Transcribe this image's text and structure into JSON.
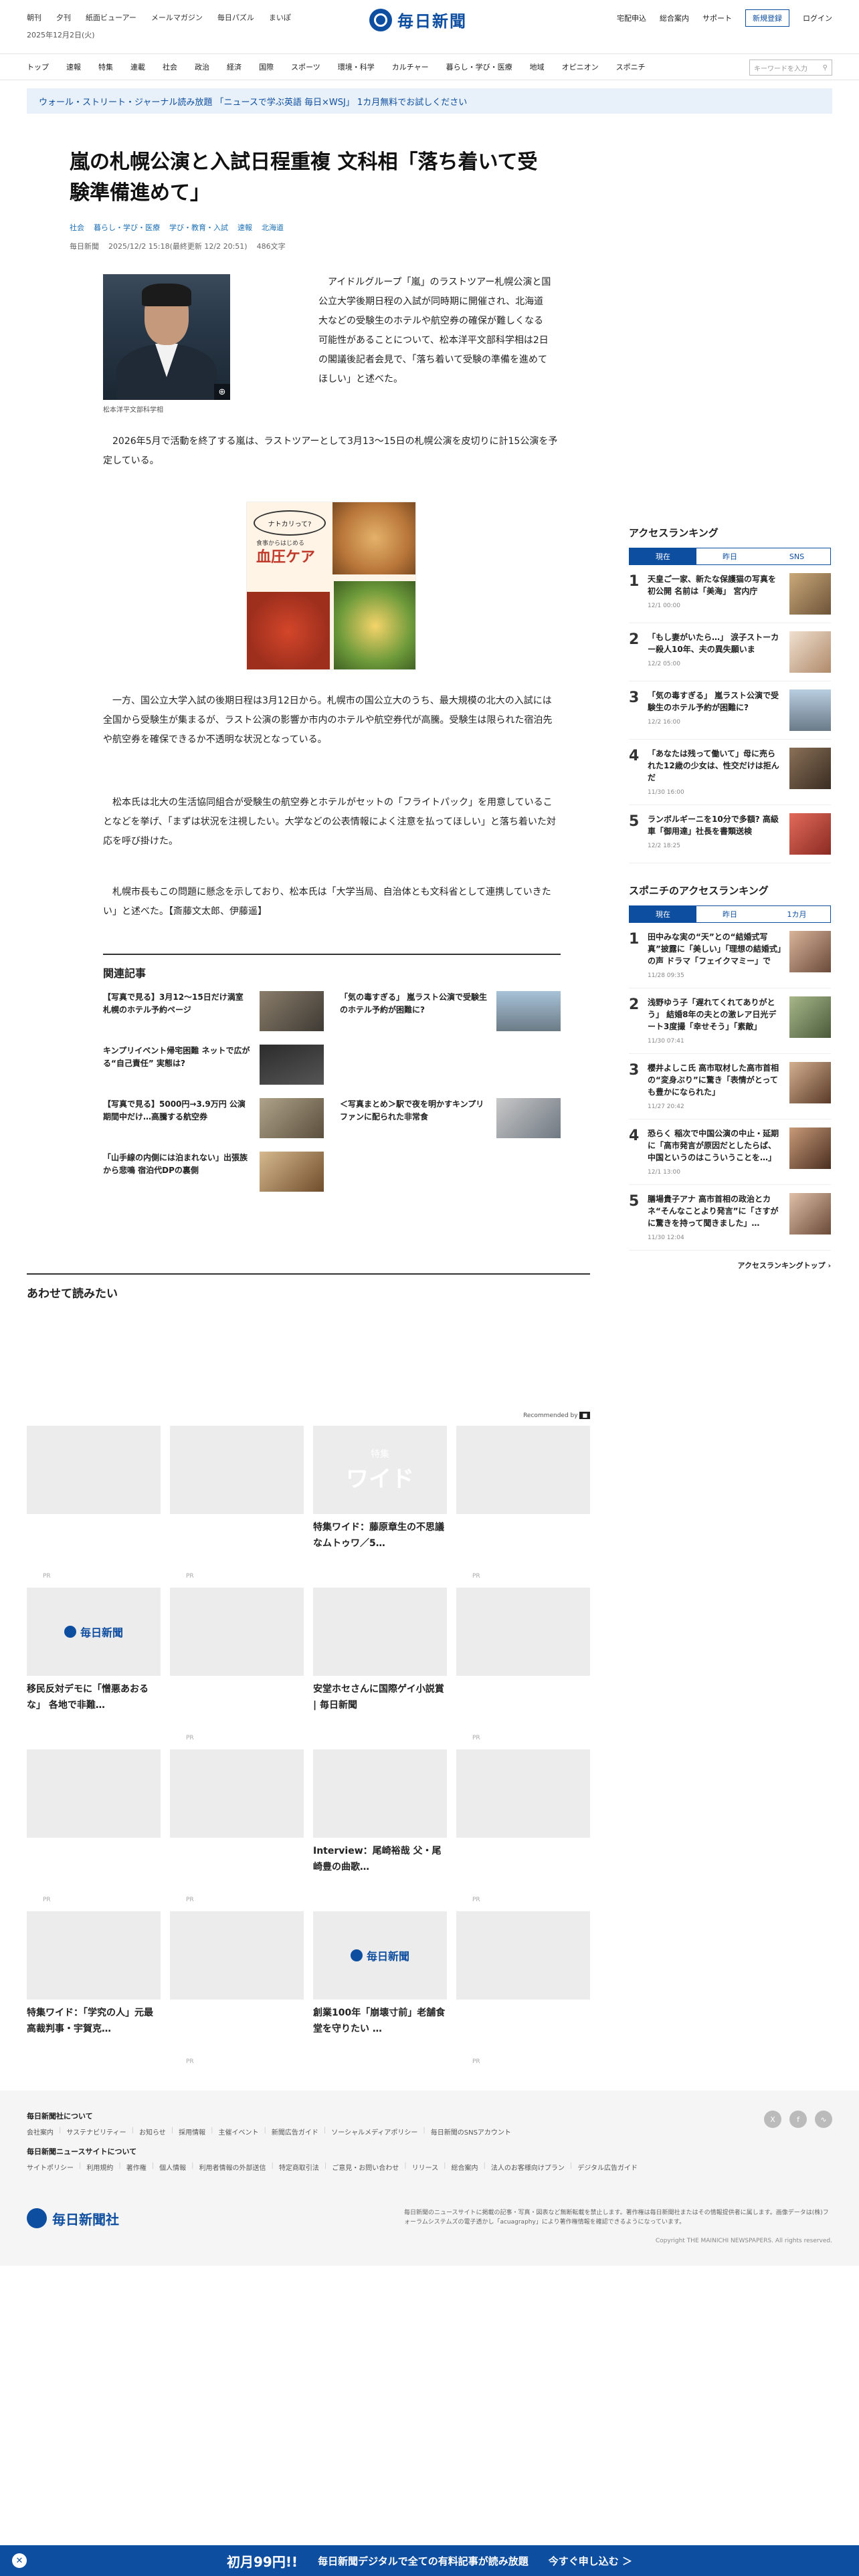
{
  "header": {
    "top_links": [
      "朝刊",
      "夕刊",
      "紙面ビューアー",
      "メールマガジン",
      "毎日パズル",
      "まいぽ"
    ],
    "date": "2025年12月2日(火)",
    "logo": "毎日新聞",
    "right_links": [
      "宅配申込",
      "総合案内",
      "サポート"
    ],
    "register": "新規登録",
    "login": "ログイン"
  },
  "nav": {
    "items": [
      "トップ",
      "速報",
      "特集",
      "連載",
      "社会",
      "政治",
      "経済",
      "国際",
      "スポーツ",
      "環境・科学",
      "カルチャー",
      "暮らし・学び・医療",
      "地域",
      "オピニオン",
      "スポニチ"
    ],
    "search_placeholder": "キーワードを入力"
  },
  "promo": "ウォール・ストリート・ジャーナル読み放題 「ニュースで学ぶ英語 毎日×WSJ」 1カ月無料でお試しください",
  "article": {
    "title": "嵐の札幌公演と入試日程重複 文科相「落ち着いて受験準備進めて」",
    "categories": [
      "社会",
      "暮らし・学び・医療",
      "学び・教育・入試",
      "速報",
      "北海道"
    ],
    "meta": [
      "毎日新聞",
      "2025/12/2 15:18(最終更新 12/2 20:51)",
      "486文字"
    ],
    "photo_caption": "松本洋平文部科学相",
    "paragraphs": [
      "アイドルグループ「嵐」のラストツアー札幌公演と国公立大学後期日程の入試が同時期に開催され、北海道大などの受験生のホテルや航空券の確保が難しくなる可能性があることについて、松本洋平文部科学相は2日の閣議後記者会見で、「落ち着いて受験の準備を進めてほしい」と述べた。",
      "2026年5月で活動を終了する嵐は、ラストツアーとして3月13～15日の札幌公演を皮切りに計15公演を予定している。",
      "一方、国公立大学入試の後期日程は3月12日から。札幌市の国公立大のうち、最大規模の北大の入試には全国から受験生が集まるが、ラスト公演の影響か市内のホテルや航空券代が高騰。受験生は限られた宿泊先や航空券を確保できるか不透明な状況となっている。",
      "松本氏は北大の生活協同組合が受験生の航空券とホテルがセットの「フライトパック」を用意していることなどを挙げ、「まずは状況を注視したい。大学などの公表情報によく注意を払ってほしい」と落ち着いた対応を呼び掛けた。",
      "札幌市長もこの問題に懸念を示しており、松本氏は「大学当局、自治体とも文科省として連携していきたい」と述べた。【斎藤文太郎、伊藤遥】"
    ],
    "ad": {
      "bubble": "ナトカリって?",
      "sub": "食事からはじめる",
      "title": "血圧ケア"
    }
  },
  "related": {
    "heading": "関連記事",
    "items": [
      "【写真で見る】3月12～15日だけ満室 札幌のホテル予約ページ",
      "「気の毒すぎる」 嵐ラスト公演で受験生のホテル予約が困難に?",
      "キンプリイベント帰宅困難 ネットで広がる“自己責任” 実態は?",
      "",
      "【写真で見る】5000円→3.9万円 公演期間中だけ…高騰する航空券",
      "＜写真まとめ＞駅で夜を明かすキンプリファンに配られた非常食",
      "「山手線の内側には泊まれない」出張族から悲鳴 宿泊代DPの裏側"
    ]
  },
  "ranking": {
    "title": "アクセスランキング",
    "tabs": [
      "現在",
      "昨日",
      "SNS"
    ],
    "items": [
      {
        "n": "1",
        "text": "天皇ご一家、新たな保護猫の写真を初公開 名前は「美海」 宮内庁",
        "time": "12/1 00:00"
      },
      {
        "n": "2",
        "text": "「もし妻がいたら…」 涙子ストーカー殺人10年、夫の異失願いま",
        "time": "12/2 05:00"
      },
      {
        "n": "3",
        "text": "「気の毒すぎる」 嵐ラスト公演で受験生のホテル予約が困難に?",
        "time": "12/2 16:00"
      },
      {
        "n": "4",
        "text": "「あなたは残って働いて」母に売られた12歳の少女は、性交だけは拒んだ",
        "time": "11/30 16:00"
      },
      {
        "n": "5",
        "text": "ランボルギーニを10分で多額? 高級車「御用達」社長を書類送検",
        "time": "12/2 18:25"
      }
    ],
    "more": ""
  },
  "sponichi": {
    "title": "スポニチのアクセスランキング",
    "tabs": [
      "現在",
      "昨日",
      "1カ月"
    ],
    "items": [
      {
        "n": "1",
        "text": "田中みな実の“天”との“結婚式写真”披露に「美しい」「理想の結婚式」の声 ドラマ「フェイクマミー」で",
        "time": "11/28 09:35"
      },
      {
        "n": "2",
        "text": "浅野ゆう子「遅れてくれてありがとう」 結婚8年の夫との激レア日光デート3度撮「幸せそう」「素敵」",
        "time": "11/30 07:41"
      },
      {
        "n": "3",
        "text": "櫻井よしこ氏 高市取材した高市首相の“変身ぶり”に驚き「表情がとっても豊かになられた」",
        "time": "11/27 20:42"
      },
      {
        "n": "4",
        "text": "恐らく 稲次で中国公演の中止・延期に「高市発言が原因だとしたらば、中国というのはこういうことを…」",
        "time": "12/1 13:00"
      },
      {
        "n": "5",
        "text": "膳場貴子アナ 高市首相の政治とカネ“そんなことより発言”に「さすがに驚きを持って聞きました」…",
        "time": "11/30 12:04"
      }
    ],
    "more": "アクセスランキングトップ"
  },
  "alsoread": {
    "heading": "あわせて読みたい",
    "recommended": "Recommended by",
    "cards": [
      {
        "text": "",
        "pr": "PR"
      },
      {
        "text": "",
        "pr": "PR"
      },
      {
        "text": "特集ワイド：藤原章生の不思議なムトゥワ／5…",
        "pr": "",
        "feat_a": "特集",
        "feat_b": "ワイド"
      },
      {
        "text": "",
        "pr": "PR"
      },
      {
        "text": "移民反対デモに「憎悪あおるな」 各地で非難…",
        "pr": ""
      },
      {
        "text": "",
        "pr": "PR"
      },
      {
        "text": "安堂ホセさんに国際ゲイ小説賞 | 毎日新聞",
        "pr": ""
      },
      {
        "text": "",
        "pr": "PR"
      },
      {
        "text": "",
        "pr": "PR"
      },
      {
        "text": "",
        "pr": "PR"
      },
      {
        "text": "Interview：尾崎裕哉 父・尾崎豊の曲歌…",
        "pr": ""
      },
      {
        "text": "",
        "pr": "PR"
      },
      {
        "text": "特集ワイド：「学究の人」元最高裁判事・宇賀克…",
        "pr": ""
      },
      {
        "text": "",
        "pr": "PR"
      },
      {
        "text": "創業100年「崩壊寸前」老舗食堂を守りたい …",
        "pr": ""
      },
      {
        "text": "",
        "pr": "PR"
      }
    ]
  },
  "footer": {
    "h1": "毎日新聞社について",
    "links1": [
      "会社案内",
      "サステナビリティー",
      "お知らせ",
      "採用情報",
      "主催イベント",
      "新聞広告ガイド",
      "ソーシャルメディアポリシー",
      "毎日新聞のSNSアカウント"
    ],
    "h2": "毎日新聞ニュースサイトについて",
    "links2": [
      "サイトポリシー",
      "利用規約",
      "著作権",
      "個人情報",
      "利用者情報の外部送信",
      "特定商取引法",
      "ご意見・お問い合わせ",
      "リリース",
      "総合案内",
      "法人のお客様向けプラン",
      "デジタル広告ガイド"
    ],
    "logo": "毎日新聞社",
    "note": "毎日新聞のニュースサイトに掲載の記事・写真・図表など無断転載を禁止します。著作権は毎日新聞社またはその情報提供者に属します。画像データは(株)フォーラムシステムズの電子透かし「acuagraphy」により著作権情報を確認できるようになっています。",
    "copyright": "Copyright THE MAINICHI NEWSPAPERS. All rights reserved."
  },
  "bottom": {
    "p1": "初月99円!!",
    "p2": "毎日新聞デジタルで全ての有料記事が読み放題",
    "p3": "今すぐ申し込む ＞"
  }
}
